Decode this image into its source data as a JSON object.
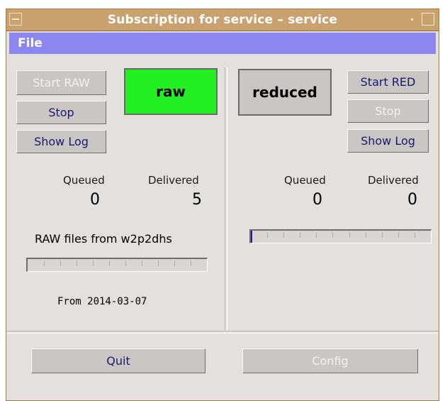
{
  "window": {
    "title": "Subscription for service – service"
  },
  "menu": {
    "file_label": "File"
  },
  "raw_panel": {
    "start_label": "Start RAW",
    "stop_label": "Stop",
    "show_log_label": "Show Log",
    "status_text": "raw",
    "status_color": "#22f022",
    "queued_label": "Queued",
    "queued_value": "0",
    "delivered_label": "Delivered",
    "delivered_value": "5",
    "source_text": "RAW files from w2p2dhs",
    "progress_fraction": 0.0,
    "from_text": "From 2014-03-07"
  },
  "red_panel": {
    "start_label": "Start RED",
    "stop_label": "Stop",
    "show_log_label": "Show Log",
    "status_text": "reduced",
    "status_color": "#c9c6c3",
    "queued_label": "Queued",
    "queued_value": "0",
    "delivered_label": "Delivered",
    "delivered_value": "0",
    "progress_fraction": 0.0
  },
  "footer": {
    "quit_label": "Quit",
    "config_label": "Config"
  },
  "colors": {
    "titlebar": "#c9a270",
    "menubar": "#8c86f0",
    "window_bg": "#e3e0dd",
    "button_text": "#1a1a6a"
  }
}
